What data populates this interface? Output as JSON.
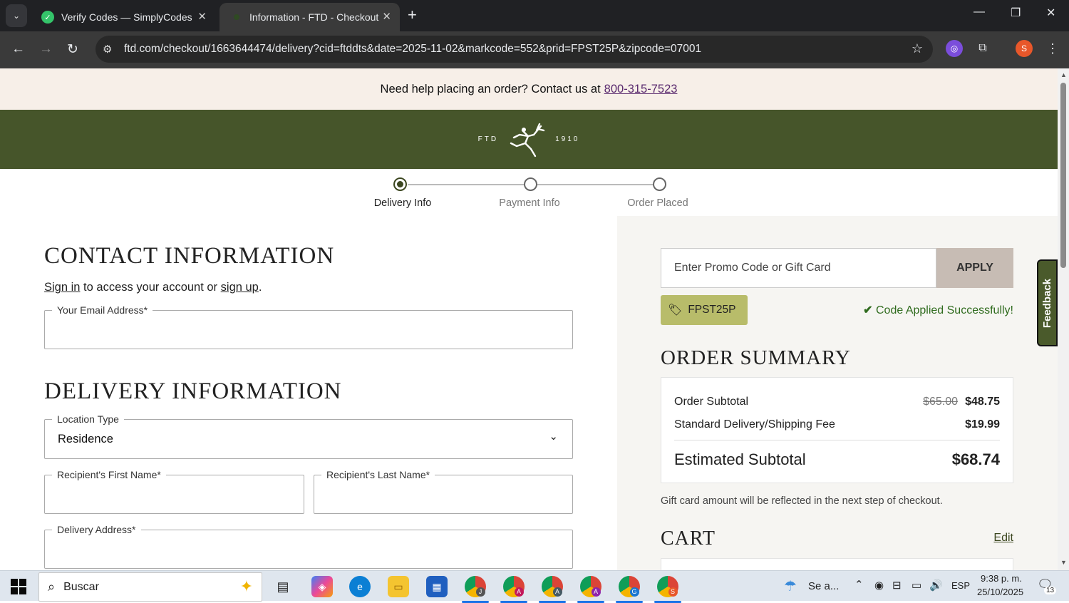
{
  "browser": {
    "tabs": [
      {
        "title": "Verify Codes — SimplyCodes",
        "active": false,
        "favicon": "simplycodes-icon"
      },
      {
        "title": "Information - FTD - Checkout",
        "active": true,
        "favicon": "ftd-icon"
      }
    ],
    "url": "ftd.com/checkout/1663644474/delivery?cid=ftddts&date=2025-11-02&markcode=552&prid=FPST25P&zipcode=07001",
    "profile_initial": "S"
  },
  "page": {
    "help_text": "Need help placing an order? Contact us at",
    "help_phone": "800-315-7523",
    "brand": {
      "left": "FTD",
      "right": "1910"
    },
    "steps": [
      {
        "label": "Delivery Info",
        "state": "active"
      },
      {
        "label": "Payment Info",
        "state": "pending"
      },
      {
        "label": "Order Placed",
        "state": "pending"
      }
    ],
    "contact": {
      "title": "CONTACT INFORMATION",
      "signin": "Sign in",
      "middle": "to access your account or",
      "signup": "sign up",
      "end": ".",
      "email_label": "Your Email Address*",
      "email_value": ""
    },
    "delivery": {
      "title": "DELIVERY INFORMATION",
      "location_label": "Location Type",
      "location_value": "Residence",
      "first_label": "Recipient's First Name*",
      "last_label": "Recipient's Last Name*",
      "address_label": "Delivery Address*"
    },
    "promo": {
      "placeholder": "Enter Promo Code or Gift Card",
      "apply": "APPLY",
      "code": "FPST25P",
      "success": "Code Applied Successfully!"
    },
    "summary": {
      "title": "ORDER SUMMARY",
      "subtotal_label": "Order Subtotal",
      "subtotal_old": "$65.00",
      "subtotal": "$48.75",
      "shipping_label": "Standard Delivery/Shipping Fee",
      "shipping": "$19.99",
      "est_label": "Estimated Subtotal",
      "est": "$68.74",
      "gift_note": "Gift card amount will be reflected in the next step of checkout."
    },
    "cart": {
      "title": "CART",
      "edit": "Edit"
    },
    "feedback": "Feedback"
  },
  "taskbar": {
    "search": "Buscar",
    "weather": "Se a...",
    "lang": "ESP",
    "time": "9:38 p. m.",
    "date": "25/10/2025",
    "notifications": "13",
    "chrome_profiles": [
      "J",
      "A",
      "A",
      "A",
      "G",
      "S"
    ]
  }
}
